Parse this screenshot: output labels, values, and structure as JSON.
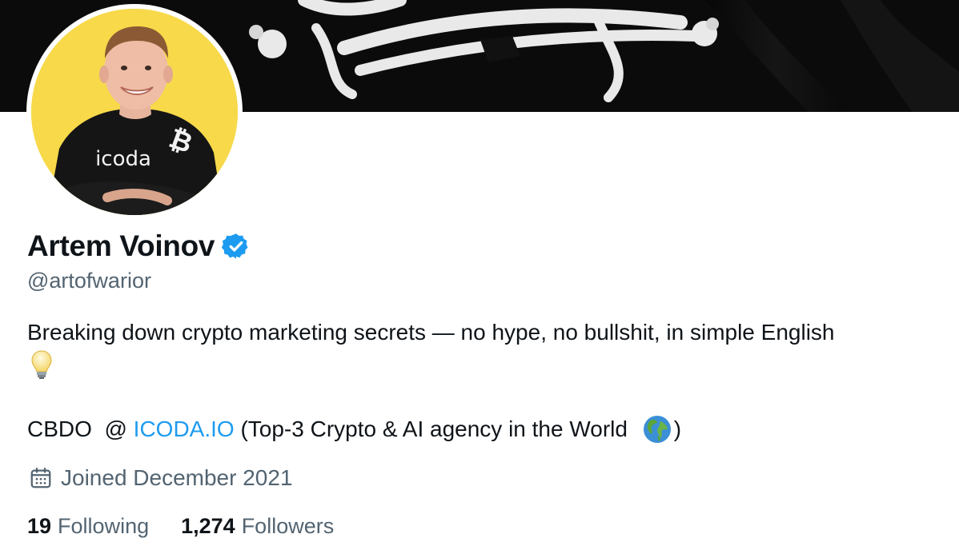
{
  "profile": {
    "name": "Artem Voinov",
    "handle": "@artofwarior",
    "bio": {
      "line1": "Breaking down crypto marketing secrets — no hype, no bullshit, in simple English",
      "line2_prefix": "CBDO  @ ",
      "line2_link": "ICODA.IO",
      "line2_suffix": " (Top-3 Crypto & AI agency in the World ",
      "line2_end": ")"
    },
    "avatar_shirt_text": "icoda",
    "joined": "Joined December 2021",
    "stats": {
      "following_count": "19",
      "following_label": "Following",
      "followers_count": "1,274",
      "followers_label": "Followers"
    }
  },
  "colors": {
    "link": "#1d9bf0",
    "secondary_text": "#536471",
    "verified_badge": "#1d9bf0",
    "avatar_background": "#f7d94a",
    "banner_background": "#0b0b0b"
  },
  "icons": [
    "verified-badge-icon",
    "lightbulb-icon",
    "globe-icon",
    "calendar-icon"
  ]
}
